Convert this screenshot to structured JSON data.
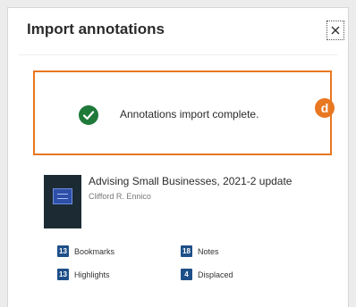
{
  "dialog": {
    "title": "Import annotations",
    "close_label": "×"
  },
  "status": {
    "message": "Annotations import complete.",
    "icon": "check-circle-icon",
    "success_color": "#1f7a3a",
    "highlight_color": "#e87722"
  },
  "callout": {
    "label": "d"
  },
  "book": {
    "title": "Advising Small Businesses, 2021-2 update",
    "author": "Clifford R. Ennico"
  },
  "stats": {
    "bookmarks": {
      "count": "13",
      "label": "Bookmarks"
    },
    "highlights": {
      "count": "13",
      "label": "Highlights"
    },
    "notes": {
      "count": "18",
      "label": "Notes"
    },
    "displaced": {
      "count": "4",
      "label": "Displaced"
    }
  }
}
